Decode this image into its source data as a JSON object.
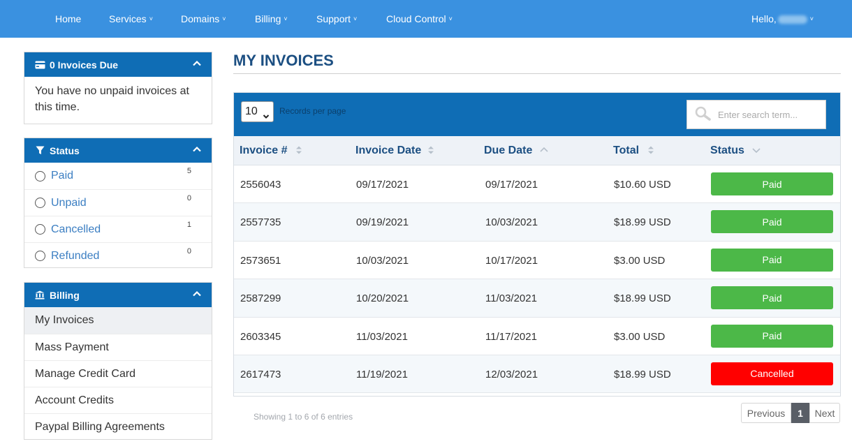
{
  "nav": {
    "items": [
      {
        "label": "Home",
        "dropdown": false
      },
      {
        "label": "Services",
        "dropdown": true
      },
      {
        "label": "Domains",
        "dropdown": true
      },
      {
        "label": "Billing",
        "dropdown": true
      },
      {
        "label": "Support",
        "dropdown": true
      },
      {
        "label": "Cloud Control",
        "dropdown": true
      }
    ],
    "greeting": "Hello,"
  },
  "sidebar": {
    "invoices_due": {
      "title": "0 Invoices Due",
      "message": "You have no unpaid invoices at this time."
    },
    "status": {
      "title": "Status",
      "items": [
        {
          "label": "Paid",
          "count": "5"
        },
        {
          "label": "Unpaid",
          "count": "0"
        },
        {
          "label": "Cancelled",
          "count": "1"
        },
        {
          "label": "Refunded",
          "count": "0"
        }
      ]
    },
    "billing": {
      "title": "Billing",
      "items": [
        {
          "label": "My Invoices",
          "active": true
        },
        {
          "label": "Mass Payment",
          "active": false
        },
        {
          "label": "Manage Credit Card",
          "active": false
        },
        {
          "label": "Account Credits",
          "active": false
        },
        {
          "label": "Paypal Billing Agreements",
          "active": false
        }
      ]
    }
  },
  "main": {
    "title": "MY INVOICES",
    "records_per_page": {
      "value": "10",
      "label": "Records per page"
    },
    "search": {
      "placeholder": "Enter search term..."
    },
    "columns": [
      "Invoice #",
      "Invoice Date",
      "Due Date",
      "Total",
      "Status"
    ],
    "rows": [
      {
        "invoice": "2556043",
        "invoice_date": "09/17/2021",
        "due_date": "09/17/2021",
        "total": "$10.60 USD",
        "status": "Paid"
      },
      {
        "invoice": "2557735",
        "invoice_date": "09/19/2021",
        "due_date": "10/03/2021",
        "total": "$18.99 USD",
        "status": "Paid"
      },
      {
        "invoice": "2573651",
        "invoice_date": "10/03/2021",
        "due_date": "10/17/2021",
        "total": "$3.00 USD",
        "status": "Paid"
      },
      {
        "invoice": "2587299",
        "invoice_date": "10/20/2021",
        "due_date": "11/03/2021",
        "total": "$18.99 USD",
        "status": "Paid"
      },
      {
        "invoice": "2603345",
        "invoice_date": "11/03/2021",
        "due_date": "11/17/2021",
        "total": "$3.00 USD",
        "status": "Paid"
      },
      {
        "invoice": "2617473",
        "invoice_date": "11/19/2021",
        "due_date": "12/03/2021",
        "total": "$18.99 USD",
        "status": "Cancelled"
      }
    ],
    "info": "Showing 1 to 6 of 6 entries",
    "pagination": {
      "previous": "Previous",
      "current": "1",
      "next": "Next"
    }
  },
  "colors": {
    "nav_bg": "#3a91e0",
    "panel_head": "#0f6db5",
    "title": "#1c4f82",
    "link": "#3b7ec2",
    "paid": "#4cb848",
    "cancelled": "#ff0000"
  }
}
